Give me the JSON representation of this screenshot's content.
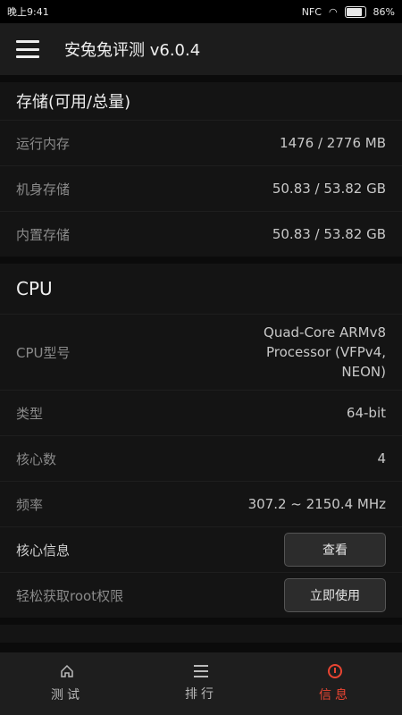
{
  "status_bar": {
    "time": "晚上9:41",
    "nfc": "NFC",
    "battery_pct": "86%"
  },
  "app_bar": {
    "title": "安兔兔评测 v6.0.4"
  },
  "storage": {
    "title": "存储(可用/总量)",
    "rows": [
      {
        "label": "运行内存",
        "value": "1476 / 2776 MB"
      },
      {
        "label": "机身存储",
        "value": "50.83 / 53.82 GB"
      },
      {
        "label": "内置存储",
        "value": "50.83 / 53.82 GB"
      }
    ]
  },
  "cpu": {
    "title": "CPU",
    "model_label": "CPU型号",
    "model_value": "Quad-Core ARMv8\nProcessor (VFPv4,\nNEON)",
    "rows": [
      {
        "label": "类型",
        "value": "64-bit"
      },
      {
        "label": "核心数",
        "value": "4"
      },
      {
        "label": "频率",
        "value": "307.2 ~ 2150.4 MHz"
      }
    ],
    "core_info_label": "核心信息",
    "core_info_button": "查看",
    "root_label": "轻松获取root权限",
    "root_button": "立即使用"
  },
  "bottom_nav": {
    "items": [
      {
        "label": "测试",
        "icon": "home-icon",
        "active": false
      },
      {
        "label": "排行",
        "icon": "list-icon",
        "active": false
      },
      {
        "label": "信息",
        "icon": "info-icon",
        "active": true
      }
    ]
  },
  "colors": {
    "accent": "#e94532",
    "background": "#0b0b0b",
    "panel": "#141414",
    "app_bar": "#1c1c1c"
  }
}
